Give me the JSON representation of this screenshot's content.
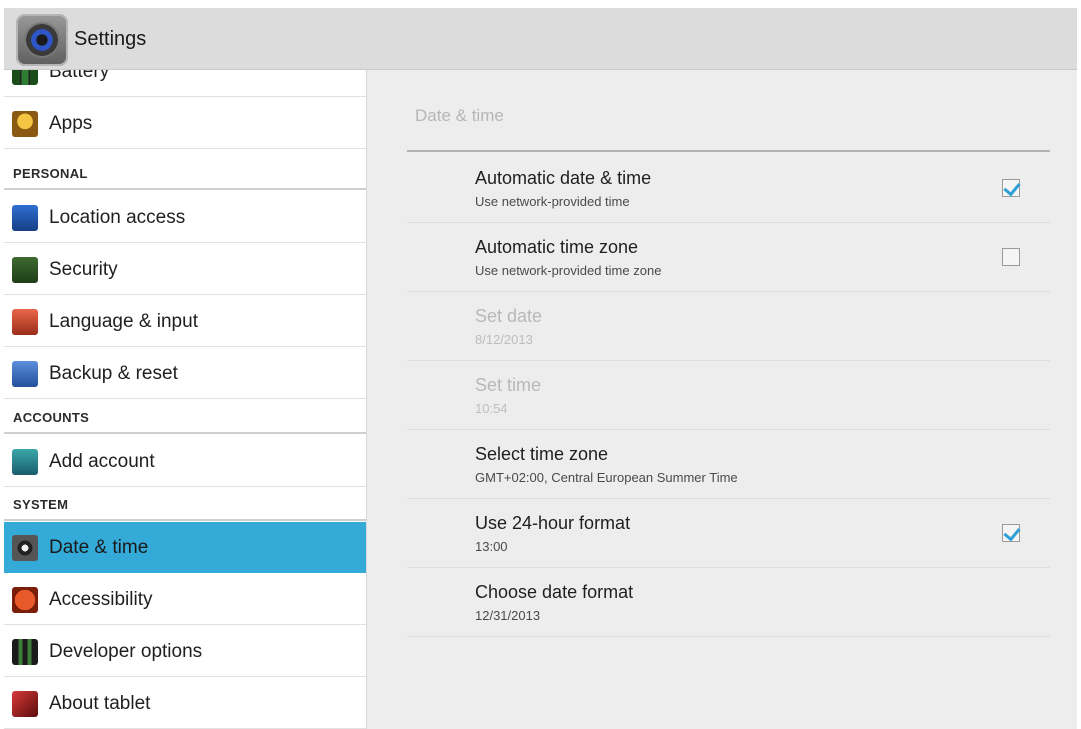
{
  "app": {
    "title": "Settings",
    "icon": "settings-gear-icon"
  },
  "sidebar": {
    "items": [
      {
        "label": "Battery",
        "icon": "battery-icon"
      },
      {
        "label": "Apps",
        "icon": "apps-icon"
      },
      {
        "label": "Location access",
        "icon": "location-icon"
      },
      {
        "label": "Security",
        "icon": "lock-icon"
      },
      {
        "label": "Language & input",
        "icon": "language-icon"
      },
      {
        "label": "Backup & reset",
        "icon": "backup-icon"
      },
      {
        "label": "Add account",
        "icon": "add-account-icon"
      },
      {
        "label": "Date & time",
        "icon": "clock-icon",
        "selected": true
      },
      {
        "label": "Accessibility",
        "icon": "accessibility-icon"
      },
      {
        "label": "Developer options",
        "icon": "developer-icon"
      },
      {
        "label": "About tablet",
        "icon": "info-icon"
      }
    ],
    "headers": {
      "personal": "PERSONAL",
      "accounts": "ACCOUNTS",
      "system": "SYSTEM"
    }
  },
  "content": {
    "title": "Date & time",
    "settings": [
      {
        "title": "Automatic date & time",
        "summary": "Use network-provided time",
        "checkbox": true,
        "checked": true,
        "enabled": true
      },
      {
        "title": "Automatic time zone",
        "summary": "Use network-provided time zone",
        "checkbox": true,
        "checked": false,
        "enabled": true
      },
      {
        "title": "Set date",
        "summary": "8/12/2013",
        "checkbox": false,
        "enabled": false
      },
      {
        "title": "Set time",
        "summary": "10:54",
        "checkbox": false,
        "enabled": false
      },
      {
        "title": "Select time zone",
        "summary": "GMT+02:00, Central European Summer Time",
        "checkbox": false,
        "enabled": true
      },
      {
        "title": "Use 24-hour format",
        "summary": "13:00",
        "checkbox": true,
        "checked": true,
        "enabled": true
      },
      {
        "title": "Choose date format",
        "summary": "12/31/2013",
        "checkbox": false,
        "enabled": true
      }
    ]
  },
  "colors": {
    "accent": "#33aad8",
    "checkmark": "#2f9fd6",
    "action_bar": "#dcdcdc",
    "content_bg": "#ededed"
  }
}
